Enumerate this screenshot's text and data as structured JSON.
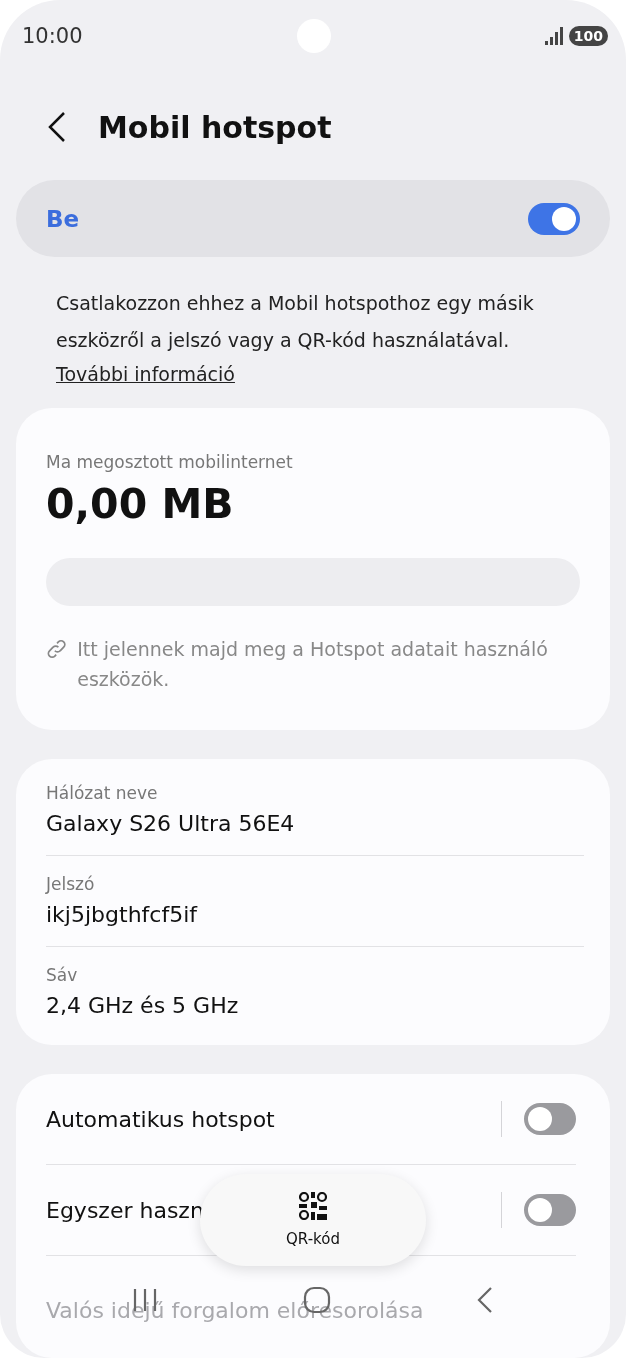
{
  "status_bar": {
    "time": "10:00",
    "battery": "100"
  },
  "header": {
    "title": "Mobil hotspot"
  },
  "master_switch": {
    "label": "Be",
    "on": true
  },
  "description": {
    "text": "Csatlakozzon ehhez a Mobil hotspothoz egy másik eszközről a jelszó vagy a QR-kód használatával.",
    "link": "További információ"
  },
  "usage": {
    "label": "Ma megosztott mobilinternet",
    "amount": "0,00 MB",
    "level": 0,
    "note": "Itt jelennek majd meg a Hotspot adatait használó eszközök."
  },
  "network": [
    {
      "label": "Hálózat neve",
      "value": "Galaxy S26 Ultra 56E4"
    },
    {
      "label": "Jelszó",
      "value": "ikj5jbgthfcf5if"
    },
    {
      "label": "Sáv",
      "value": "2,4 GHz és 5 GHz"
    }
  ],
  "options": [
    {
      "label": "Automatikus hotspot",
      "on": false
    },
    {
      "label": "Egyszer haszn",
      "on": false
    },
    {
      "label": "Valós idejű forgalom előresorolása"
    }
  ],
  "qr_button": {
    "label": "QR-kód"
  }
}
